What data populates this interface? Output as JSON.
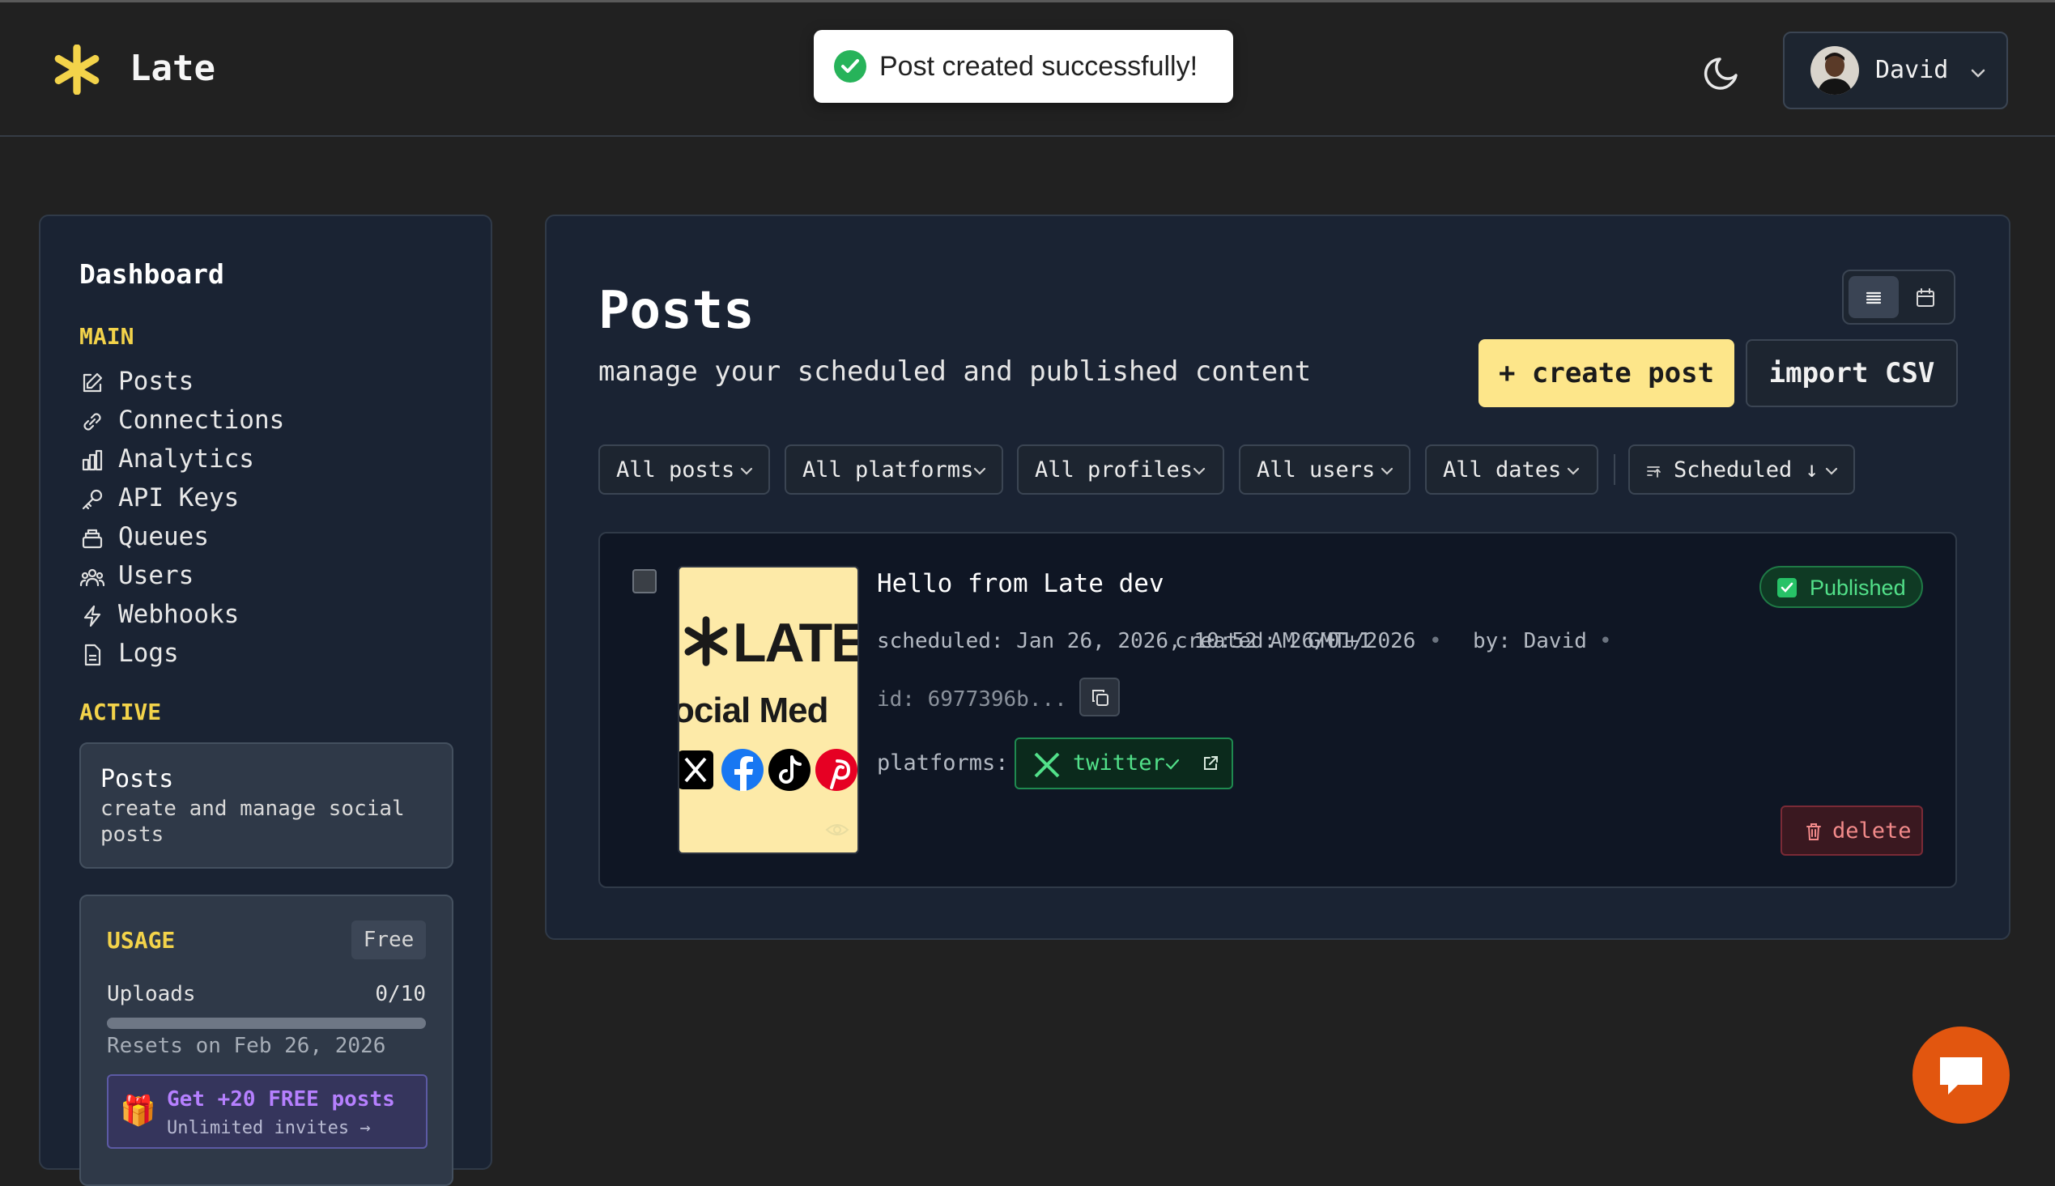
{
  "app": {
    "name": "Late"
  },
  "toast": {
    "message": "Post created successfully!"
  },
  "user": {
    "name": "David"
  },
  "sidebar": {
    "title": "Dashboard",
    "main_label": "MAIN",
    "items": [
      {
        "label": "Posts",
        "icon": "edit-icon"
      },
      {
        "label": "Connections",
        "icon": "link-icon"
      },
      {
        "label": "Analytics",
        "icon": "bar-chart-icon"
      },
      {
        "label": "API Keys",
        "icon": "key-icon"
      },
      {
        "label": "Queues",
        "icon": "queue-icon"
      },
      {
        "label": "Users",
        "icon": "users-icon"
      },
      {
        "label": "Webhooks",
        "icon": "webhook-icon"
      },
      {
        "label": "Logs",
        "icon": "file-icon"
      }
    ],
    "active_label": "ACTIVE",
    "active": {
      "title": "Posts",
      "description": "create and manage social posts"
    },
    "usage": {
      "title": "USAGE",
      "plan": "Free",
      "uploads_label": "Uploads",
      "uploads_count": "0/10",
      "uploads_used_fraction": 0,
      "resets": "Resets on Feb 26, 2026",
      "invite_title": "Get +20 FREE posts",
      "invite_sub": "Unlimited invites →"
    }
  },
  "main": {
    "title": "Posts",
    "subtitle": "manage your scheduled and published content",
    "create_label": "+ create post",
    "import_label": "import CSV",
    "filters": [
      "All posts",
      "All platforms",
      "All profiles",
      "All users",
      "All dates"
    ],
    "sort_label": "Scheduled ↓"
  },
  "post": {
    "title": "Hello from Late dev",
    "status": "Published",
    "scheduled": "scheduled: Jan 26, 2026, 10:52 AM GMT+1",
    "created": "created: 26/01/2026",
    "by": "by: David",
    "id": "id: 6977396b...",
    "platforms_label": "platforms:",
    "platform": "twitter",
    "delete_label": "delete",
    "thumbnail": {
      "brand": "LATE",
      "caption": "ocial Med"
    }
  },
  "colors": {
    "accent": "#fde68a",
    "section_label": "#f3d34a",
    "success": "#52e089",
    "danger": "#f28a8a",
    "chat": "#e2560f"
  }
}
